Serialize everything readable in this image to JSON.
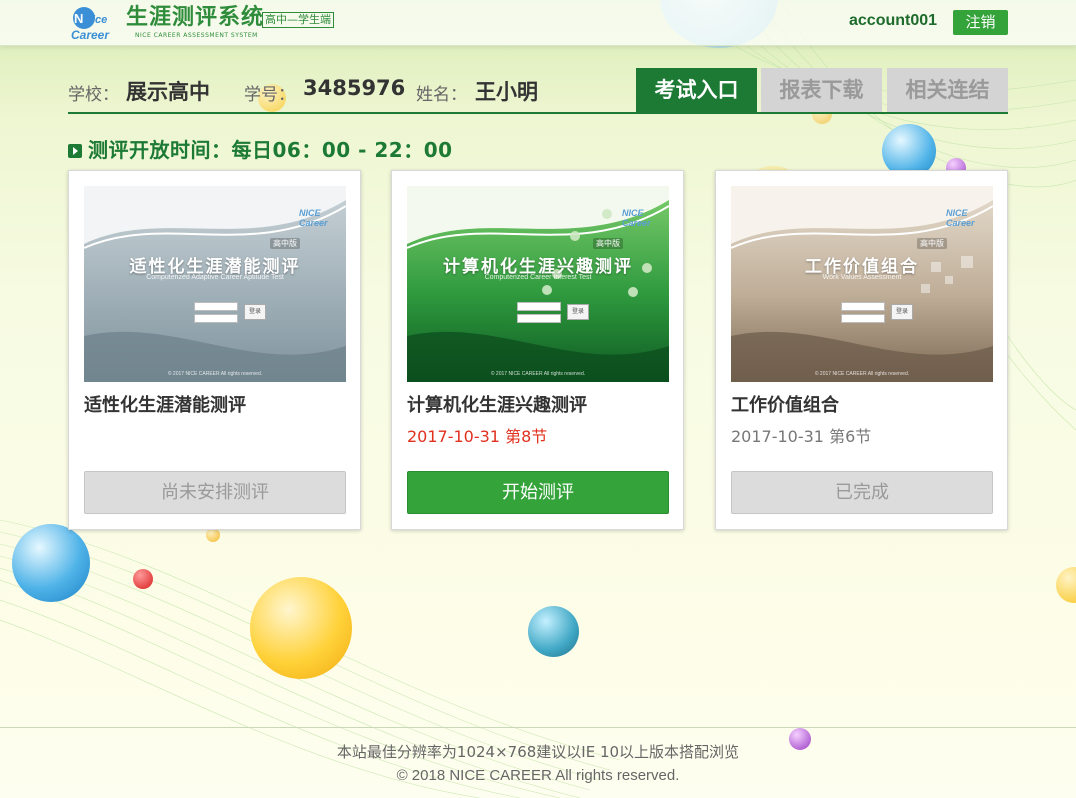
{
  "header": {
    "logo_text": "NICE Career",
    "title": "生涯测评系统",
    "subtitle": "高中—学生端",
    "subtitle_en": "NICE CAREER ASSESSMENT SYSTEM",
    "account": "account001",
    "logout_label": "注销"
  },
  "student": {
    "school_label": "学校：",
    "school": "展示高中",
    "id_label": "学号：",
    "id": "3485976",
    "name_label": "姓名：",
    "name": "王小明"
  },
  "tabs": [
    {
      "label": "考试入口",
      "active": true
    },
    {
      "label": "报表下载",
      "active": false
    },
    {
      "label": "相关连结",
      "active": false
    }
  ],
  "open_time": "测评开放时间：每日06：00 - 22：00",
  "cards": [
    {
      "title": "适性化生涯潜能测评",
      "thumb": {
        "title": "适性化生涯潜能测评",
        "subtitle": "Computerized Adaptive Career Aptitude Test",
        "badge": "高中版",
        "brand": "NICE Career",
        "login": "登录",
        "footer": "© 2017 NICE CAREER All rights reserved."
      },
      "date": "",
      "button": "尚未安排测评",
      "button_state": "disabled",
      "theme": "#8fa3ad"
    },
    {
      "title": "计算机化生涯兴趣测评",
      "thumb": {
        "title": "计算机化生涯兴趣测评",
        "subtitle": "Computerized Career Interest Test",
        "badge": "高中版",
        "brand": "NICE Career",
        "login": "登录",
        "footer": "© 2017 NICE CAREER All rights reserved."
      },
      "date": "2017-10-31  第8节",
      "date_color": "#e0301e",
      "button": "开始测评",
      "button_state": "primary",
      "theme": "#2f9a3e"
    },
    {
      "title": "工作价值组合",
      "thumb": {
        "title": "工作价值组合",
        "subtitle": "Work Values Assessment",
        "badge": "高中版",
        "brand": "NICE Career",
        "login": "登录",
        "footer": "© 2017 NICE CAREER All rights reserved."
      },
      "date": "2017-10-31  第6节",
      "date_color": "#777777",
      "button": "已完成",
      "button_state": "disabled",
      "theme": "#b8a48e"
    }
  ],
  "footer": {
    "line1": "本站最佳分辨率为1024×768建议以IE 10以上版本搭配浏览",
    "line2": "© 2018 NICE CAREER All rights reserved."
  }
}
